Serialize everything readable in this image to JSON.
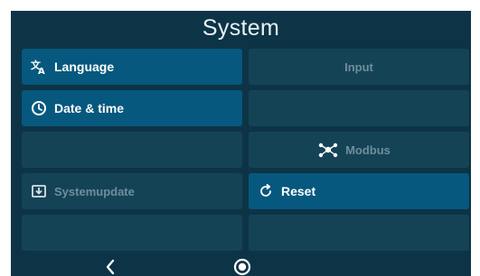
{
  "header": {
    "title": "System"
  },
  "tiles": {
    "language": {
      "label": "Language",
      "icon": "translate-icon"
    },
    "input": {
      "label": "Input"
    },
    "date_time": {
      "label": "Date & time",
      "icon": "clock-icon"
    },
    "modbus": {
      "label": "Modbus",
      "icon": "network-icon"
    },
    "systemupdate": {
      "label": "Systemupdate",
      "icon": "download-box-icon"
    },
    "reset": {
      "label": "Reset",
      "icon": "reset-arrow-icon"
    }
  },
  "nav": {
    "back_icon": "chevron-left-icon",
    "home_icon": "home-circle-icon"
  },
  "colors": {
    "background": "#0d3446",
    "tile_active": "#06587e",
    "tile_inactive": "#154356",
    "text_active": "#ffffff",
    "text_disabled": "#6e8e9c"
  }
}
